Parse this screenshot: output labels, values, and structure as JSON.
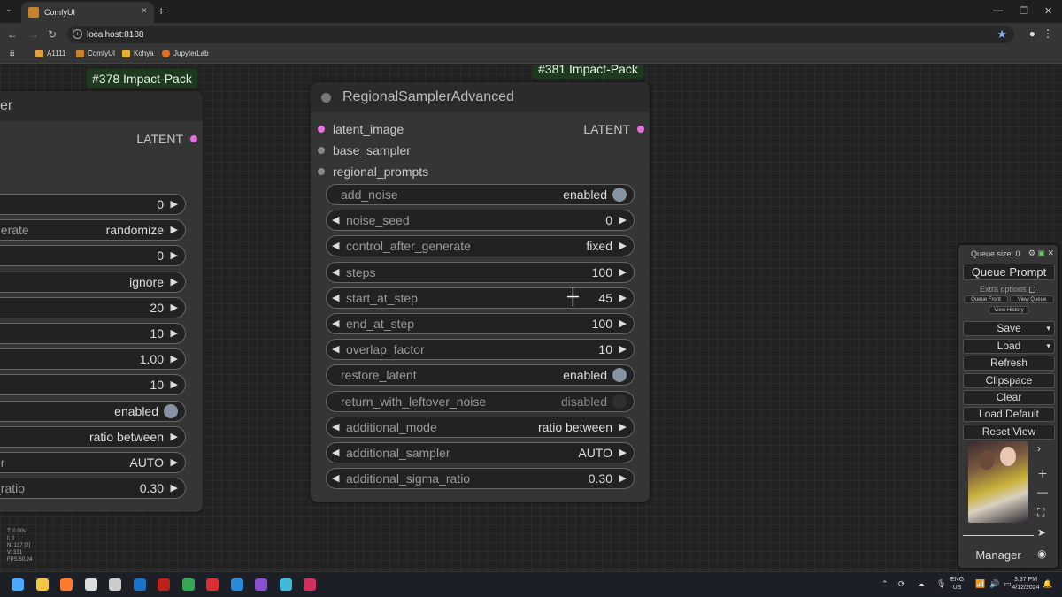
{
  "browser": {
    "tab_title": "ComfyUI",
    "tab_close": "×",
    "new_tab": "+",
    "url": "localhost:8188",
    "bookmarks": [
      {
        "label": "A1111",
        "color": "#e0a040"
      },
      {
        "label": "ComfyUI",
        "color": "#c8822a"
      },
      {
        "label": "Kohya",
        "color": "#e0b030"
      },
      {
        "label": "JupyterLab",
        "color": "#e07020"
      }
    ]
  },
  "canvas": {
    "left_badge": "#378 Impact-Pack",
    "right_badge": "#381 Impact-Pack",
    "left_node": {
      "title_fragment": "er",
      "output": "LATENT",
      "widgets": [
        {
          "label": "",
          "value": "0",
          "kind": "arrow"
        },
        {
          "label": "nerate",
          "value": "randomize",
          "kind": "arrow"
        },
        {
          "label": "",
          "value": "0",
          "kind": "arrow"
        },
        {
          "label": "",
          "value": "ignore",
          "kind": "arrow"
        },
        {
          "label": "",
          "value": "20",
          "kind": "arrow"
        },
        {
          "label": "",
          "value": "10",
          "kind": "arrow"
        },
        {
          "label": "",
          "value": "1.00",
          "kind": "arrow"
        },
        {
          "label": "",
          "value": "10",
          "kind": "arrow"
        },
        {
          "label": "",
          "value": "enabled",
          "kind": "toggle"
        },
        {
          "label": "",
          "value": "ratio between",
          "kind": "arrow"
        },
        {
          "label": "er",
          "value": "AUTO",
          "kind": "arrow"
        },
        {
          "label": "_ratio",
          "value": "0.30",
          "kind": "arrow"
        }
      ]
    },
    "main_node": {
      "title": "RegionalSamplerAdvanced",
      "inputs": [
        {
          "label": "latent_image",
          "color": "#e96ce0"
        },
        {
          "label": "base_sampler",
          "color": "#888888"
        },
        {
          "label": "regional_prompts",
          "color": "#888888"
        }
      ],
      "output": "LATENT",
      "output_color": "#e96ce0",
      "widgets": [
        {
          "label": "add_noise",
          "value": "enabled",
          "kind": "toggle"
        },
        {
          "label": "noise_seed",
          "value": "0",
          "kind": "arrow"
        },
        {
          "label": "control_after_generate",
          "value": "fixed",
          "kind": "arrow"
        },
        {
          "label": "steps",
          "value": "100",
          "kind": "arrow"
        },
        {
          "label": "start_at_step",
          "value": "45",
          "kind": "arrow"
        },
        {
          "label": "end_at_step",
          "value": "100",
          "kind": "arrow"
        },
        {
          "label": "overlap_factor",
          "value": "10",
          "kind": "arrow"
        },
        {
          "label": "restore_latent",
          "value": "enabled",
          "kind": "toggle"
        },
        {
          "label": "return_with_leftover_noise",
          "value": "disabled",
          "kind": "toggle-off"
        },
        {
          "label": "additional_mode",
          "value": "ratio between",
          "kind": "arrow"
        },
        {
          "label": "additional_sampler",
          "value": "AUTO",
          "kind": "arrow"
        },
        {
          "label": "additional_sigma_ratio",
          "value": "0.30",
          "kind": "arrow"
        }
      ]
    },
    "stats": [
      "T: 0.00s",
      "I: 0",
      "N: 137 [2]",
      "V: 331",
      "FPS:50.24"
    ]
  },
  "menu": {
    "queue_size": "Queue size: 0",
    "queue_prompt": "Queue Prompt",
    "extra_options": "Extra options",
    "queue_front": "Queue Front",
    "view_queue": "View Queue",
    "view_history": "View History",
    "buttons": [
      "Save",
      "Load",
      "Refresh",
      "Clipspace",
      "Clear",
      "Load Default",
      "Reset View"
    ],
    "manager": "Manager"
  },
  "taskbar": {
    "lang_top": "ENG",
    "lang_bottom": "US",
    "time": "3:37 PM",
    "date": "4/12/2024",
    "icons": [
      {
        "name": "windows-start",
        "color": "#4aa8ff"
      },
      {
        "name": "file-explorer",
        "color": "#f4c542"
      },
      {
        "name": "firefox",
        "color": "#ff7a2a"
      },
      {
        "name": "g-hub",
        "color": "#dddddd"
      },
      {
        "name": "obs",
        "color": "#cccccc"
      },
      {
        "name": "outlook",
        "color": "#1a73c8"
      },
      {
        "name": "filezilla",
        "color": "#c0201a"
      },
      {
        "name": "chrome",
        "color": "#34a853"
      },
      {
        "name": "app-red",
        "color": "#d83030"
      },
      {
        "name": "vscode",
        "color": "#2a8ad8"
      },
      {
        "name": "affinity",
        "color": "#8a50d0"
      },
      {
        "name": "app-teal",
        "color": "#40b8d8"
      },
      {
        "name": "indesign",
        "color": "#d03060"
      }
    ]
  }
}
